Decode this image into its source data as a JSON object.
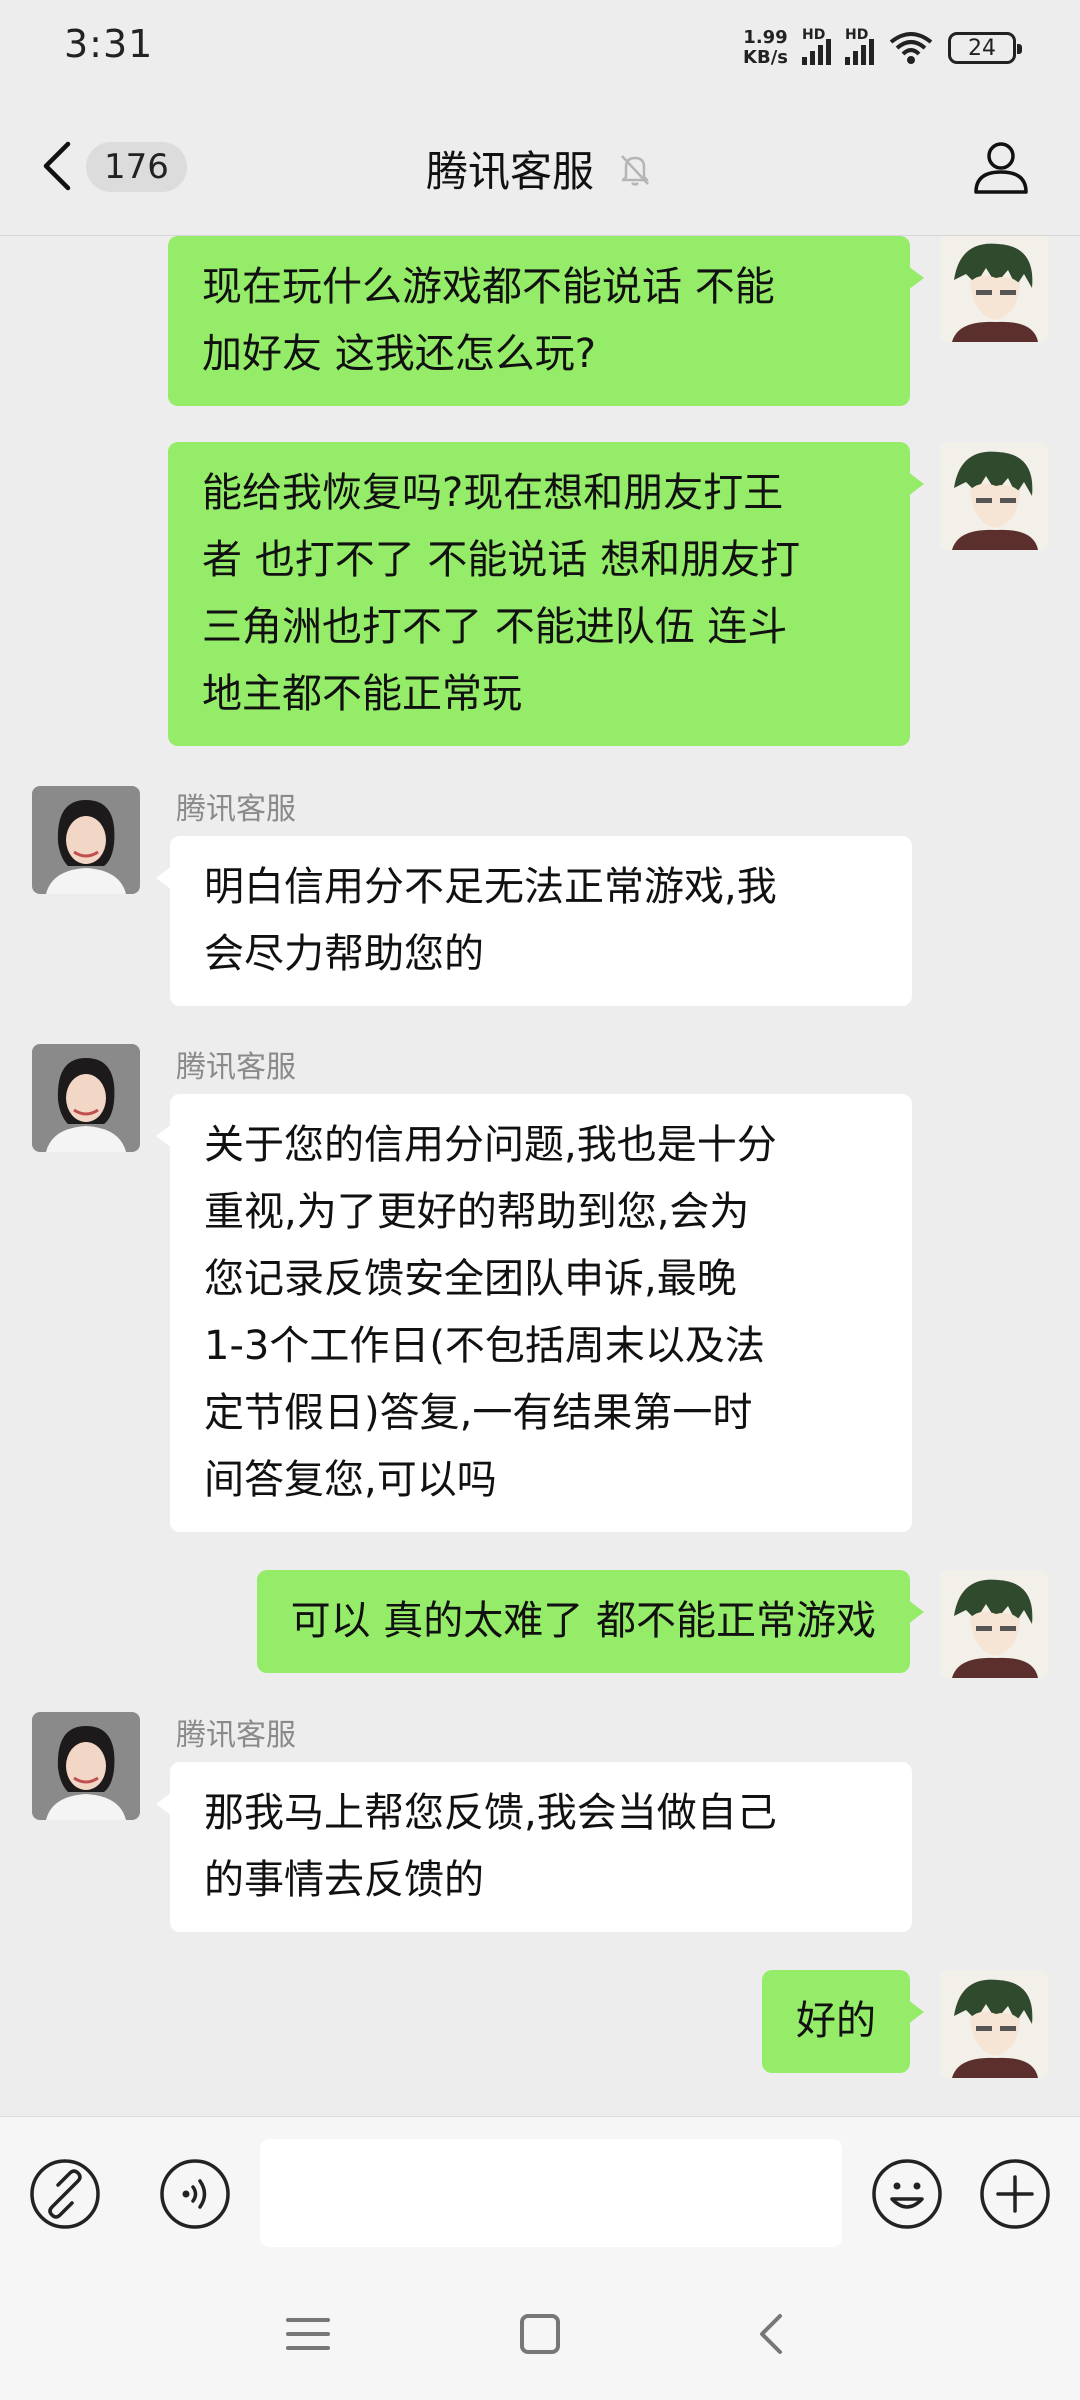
{
  "status_bar": {
    "time": "3:31",
    "net_speed_value": "1.99",
    "net_speed_unit": "KB/s",
    "hd_label": "HD",
    "battery": "24"
  },
  "header": {
    "unread_count": "176",
    "title": "腾讯客服"
  },
  "messages": [
    {
      "side": "out",
      "text_lines": [
        "现在玩什么游戏都不能说话  不能",
        "加好友 这我还怎么玩?"
      ]
    },
    {
      "side": "out",
      "text_lines": [
        "能给我恢复吗?现在想和朋友打王",
        "者 也打不了 不能说话 想和朋友打",
        "三角洲也打不了 不能进队伍 连斗",
        "地主都不能正常玩"
      ]
    },
    {
      "side": "in",
      "sender": "腾讯客服",
      "text_lines": [
        "明白信用分不足无法正常游戏,我",
        "会尽力帮助您的"
      ]
    },
    {
      "side": "in",
      "sender": "腾讯客服",
      "text_lines": [
        "关于您的信用分问题,我也是十分",
        "重视,为了更好的帮助到您,会为",
        "您记录反馈安全团队申诉,最晚",
        "1-3个工作日(不包括周末以及法",
        "定节假日)答复,一有结果第一时",
        "间答复您,可以吗"
      ]
    },
    {
      "side": "out",
      "text_lines": [
        "可以 真的太难了 都不能正常游戏"
      ]
    },
    {
      "side": "in",
      "sender": "腾讯客服",
      "text_lines": [
        "那我马上帮您反馈,我会当做自己",
        "的事情去反馈的"
      ]
    },
    {
      "side": "out",
      "text_lines": [
        "好的"
      ]
    }
  ],
  "input_bar": {
    "text_value": ""
  },
  "icons": {
    "back": "chevron-left-icon",
    "mute": "bell-off-icon",
    "profile": "person-icon",
    "link": "link-icon",
    "voice": "voice-icon",
    "emoji": "smile-icon",
    "plus": "plus-icon",
    "nav_menu": "menu-icon",
    "nav_home": "home-square-icon",
    "nav_back": "back-triangle-icon"
  },
  "colors": {
    "outgoing_bubble": "#95ec69",
    "incoming_bubble": "#ffffff",
    "background": "#ededed"
  }
}
